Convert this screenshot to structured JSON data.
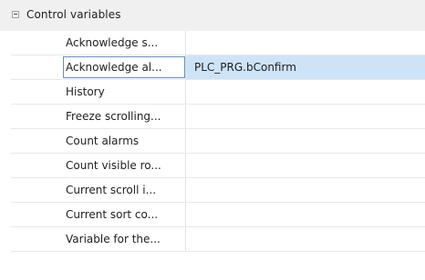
{
  "group": {
    "label": "Control variables",
    "expanded": true
  },
  "properties": [
    {
      "name": "Acknowledge s...",
      "value": ""
    },
    {
      "name": "Acknowledge al...",
      "value": "PLC_PRG.bConfirm",
      "selected": true
    },
    {
      "name": "History",
      "value": ""
    },
    {
      "name": "Freeze scrolling...",
      "value": ""
    },
    {
      "name": "Count alarms",
      "value": ""
    },
    {
      "name": "Count visible ro...",
      "value": ""
    },
    {
      "name": "Current scroll i...",
      "value": ""
    },
    {
      "name": "Current sort co...",
      "value": ""
    },
    {
      "name": "Variable for the...",
      "value": ""
    }
  ],
  "colors": {
    "selected_row": "#cfe3f7",
    "group_header": "#f0f0f0"
  }
}
